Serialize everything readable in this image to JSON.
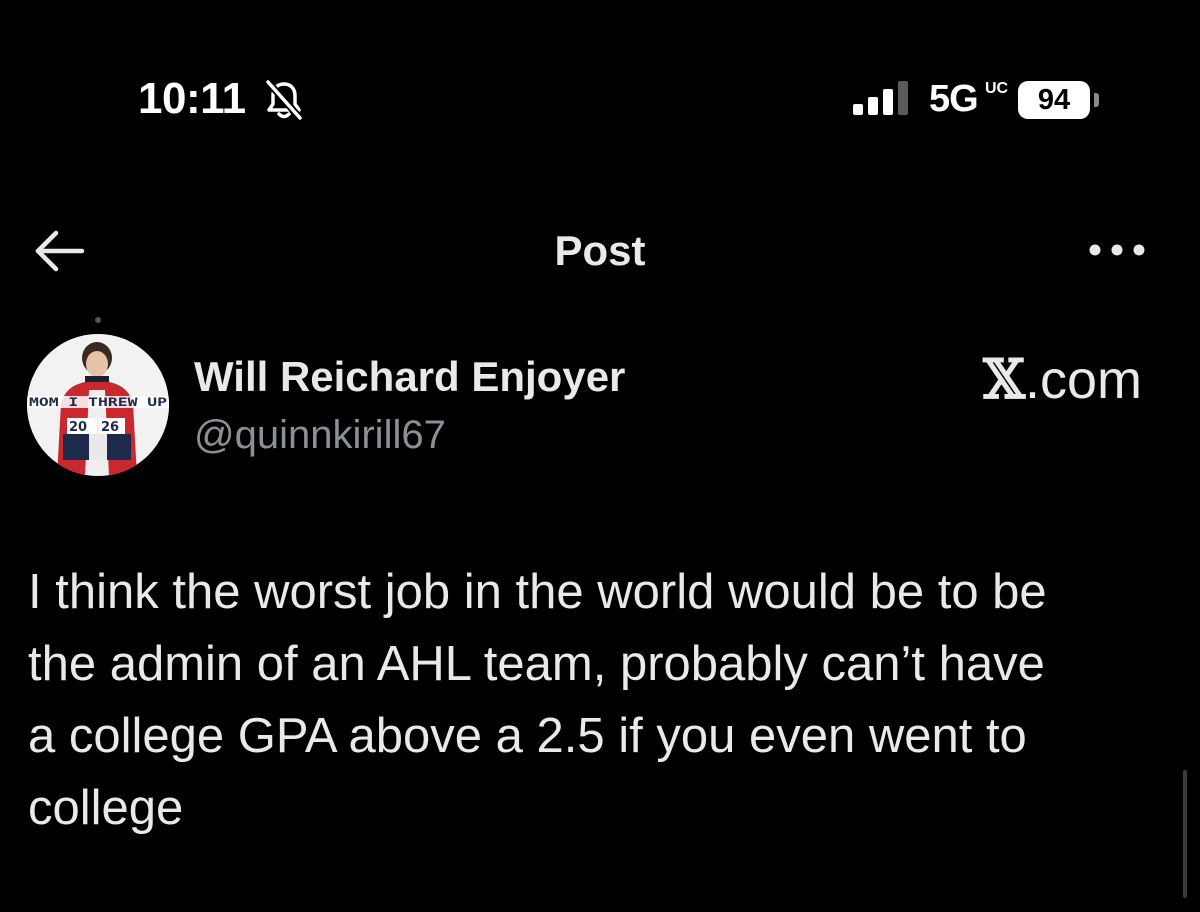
{
  "status_bar": {
    "time": "10:11",
    "network": "5G",
    "network_badge": "UC",
    "battery": "94",
    "icons": [
      "bell-slash-icon",
      "signal-bars-icon"
    ]
  },
  "nav": {
    "title": "Post",
    "icons": [
      "back-arrow-icon",
      "more-options-icon"
    ]
  },
  "post": {
    "author": {
      "name": "Will Reichard Enjoyer",
      "handle": "@quinnkirill67",
      "avatar_caption": "MOM I THREW UP",
      "avatar_numbers": [
        "20",
        "26"
      ]
    },
    "source": {
      "symbol": "𝕏",
      "suffix": ".com"
    },
    "text": "I think the worst job in the world would be to be\nthe admin of an AHL team, probably can’t have\na college GPA above a 2.5 if you even went to\ncollege"
  },
  "colors": {
    "background": "#000000",
    "primary_text": "#e7e9ea",
    "secondary_text": "#8b9096"
  }
}
